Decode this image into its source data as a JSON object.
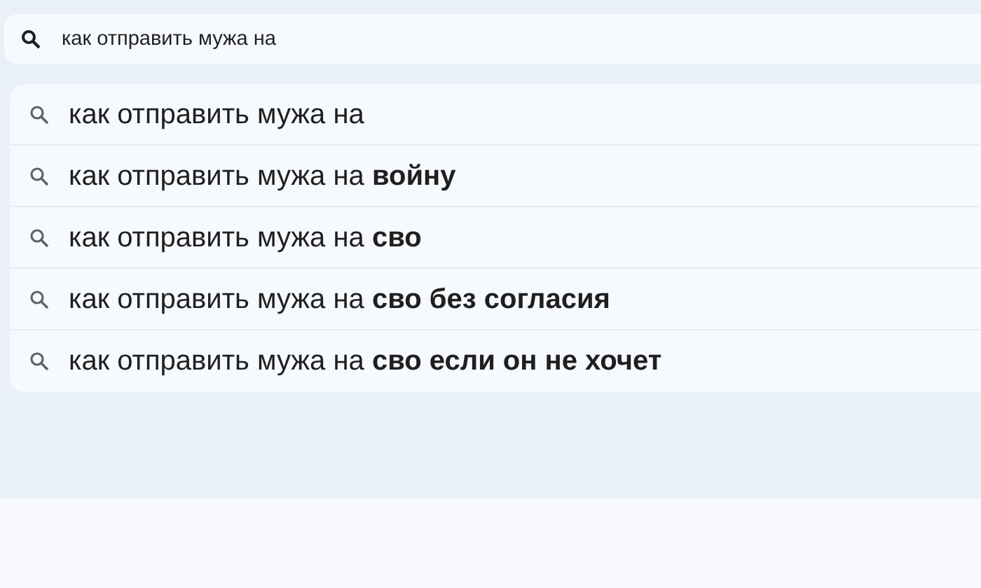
{
  "search": {
    "value": "как отправить мужа на"
  },
  "suggestions": [
    {
      "text": "как отправить мужа на"
    },
    {
      "text": "как отправить мужа на **войну**"
    },
    {
      "text": "как отправить мужа на **сво**"
    },
    {
      "text": "как отправить мужа на **сво без согласия**"
    },
    {
      "text": "как отправить мужа на **сво если он не хочет**"
    }
  ]
}
